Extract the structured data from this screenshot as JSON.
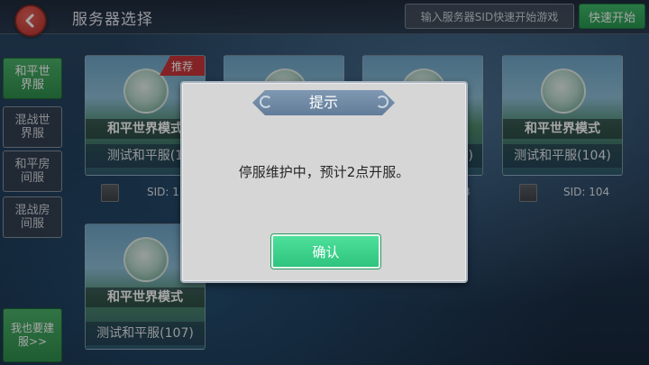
{
  "header": {
    "title": "服务器选择",
    "sid_input_placeholder": "输入服务器SID快速开始游戏",
    "quick_start_label": "快速开始"
  },
  "nav": {
    "items": [
      {
        "label": "和平世界服",
        "active": true
      },
      {
        "label": "混战世界服",
        "active": false
      },
      {
        "label": "和平房间服",
        "active": false
      },
      {
        "label": "混战房间服",
        "active": false
      }
    ],
    "build_label": "我也要建服>>"
  },
  "servers": [
    {
      "mode": "和平世界模式",
      "name": "测试和平服(1",
      "sid": "SID: 1",
      "recommended": "推荐"
    },
    {
      "mode": "",
      "name": "",
      "sid": ""
    },
    {
      "mode": "",
      "name": "5)",
      "sid": "3"
    },
    {
      "mode": "和平世界模式",
      "name": "测试和平服(104)",
      "sid": "SID: 104"
    },
    {
      "mode": "和平世界模式",
      "name": "测试和平服(107)",
      "sid": ""
    }
  ],
  "dialog": {
    "title": "提示",
    "message": "停服维护中，预计2点开服。",
    "confirm_label": "确认"
  },
  "colors": {
    "accent_green": "#3fb96a",
    "recommend_red": "#c9373a",
    "confirm_green": "#2fc47f"
  }
}
